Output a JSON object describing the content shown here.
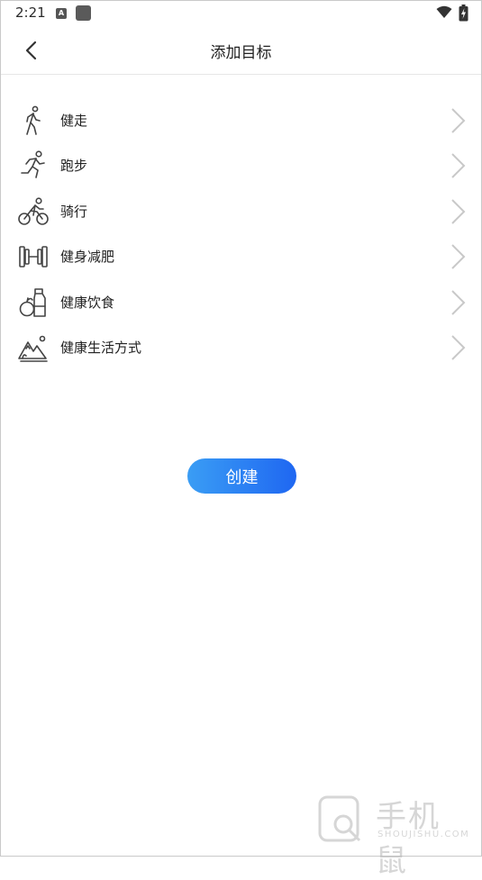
{
  "status_bar": {
    "time": "2:21",
    "notification_badge": "A"
  },
  "header": {
    "title": "添加目标"
  },
  "goals": [
    {
      "label": "健走",
      "icon": "walking-icon"
    },
    {
      "label": "跑步",
      "icon": "running-icon"
    },
    {
      "label": "骑行",
      "icon": "cycling-icon"
    },
    {
      "label": "健身减肥",
      "icon": "dumbbell-icon"
    },
    {
      "label": "健康饮食",
      "icon": "healthy-food-icon"
    },
    {
      "label": "健康生活方式",
      "icon": "lifestyle-icon"
    }
  ],
  "actions": {
    "create_label": "创建"
  },
  "watermark": {
    "text": "手机鼠",
    "sub": "SHOUJISHU.COM"
  },
  "colors": {
    "button_gradient_start": "#3a9df4",
    "button_gradient_end": "#1f67f2",
    "icon_stroke": "#444444",
    "chevron": "#c8c8c8"
  }
}
